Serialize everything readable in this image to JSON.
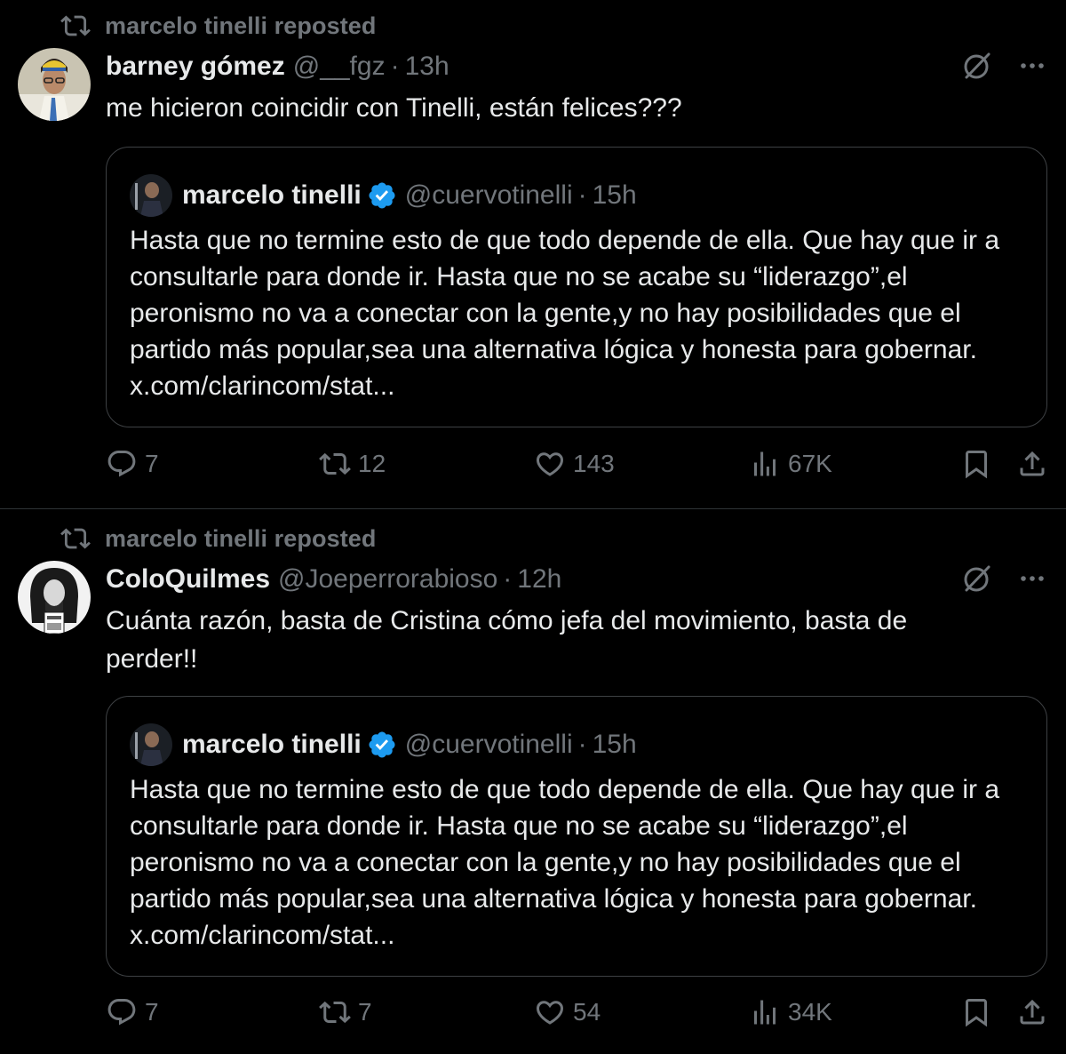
{
  "tweets": [
    {
      "reposted_by": "marcelo tinelli reposted",
      "author": {
        "name": "barney gómez",
        "handle": "@__fgz",
        "time": "13h"
      },
      "text": "me hicieron coincidir con Tinelli, están felices???",
      "quote": {
        "author": {
          "name": "marcelo tinelli",
          "handle": "@cuervotinelli",
          "time": "15h"
        },
        "text": "Hasta que no termine esto de que todo depende de ella. Que hay que ir a consultarle para donde ir. Hasta que no se acabe su “liderazgo”,el peronismo no va a conectar con la gente,y no hay posibilidades que el partido más popular,sea una alternativa lógica y honesta para gobernar. x.com/clarincom/stat..."
      },
      "stats": {
        "replies": "7",
        "reposts": "12",
        "likes": "143",
        "views": "67K"
      }
    },
    {
      "reposted_by": "marcelo tinelli reposted",
      "author": {
        "name": "ColoQuilmes",
        "handle": "@Joeperrorabioso",
        "time": "12h"
      },
      "text": "Cuánta razón, basta de Cristina cómo jefa del movimiento, basta de perder!!",
      "quote": {
        "author": {
          "name": "marcelo tinelli",
          "handle": "@cuervotinelli",
          "time": "15h"
        },
        "text": "Hasta que no termine esto de que todo depende de ella. Que hay que ir a consultarle para donde ir. Hasta que no se acabe su “liderazgo”,el peronismo no va a conectar con la gente,y no hay posibilidades que el partido más popular,sea una alternativa lógica y honesta para gobernar. x.com/clarincom/stat..."
      },
      "stats": {
        "replies": "7",
        "reposts": "7",
        "likes": "54",
        "views": "34K"
      }
    }
  ],
  "separator": "·",
  "colors": {
    "background": "#000000",
    "text": "#e7e9ea",
    "muted": "#71767b",
    "verified": "#1d9bf0",
    "border": "#3e4144"
  },
  "icons": [
    "repost-icon",
    "grok-icon",
    "more-icon",
    "verified-badge-icon",
    "reply-icon",
    "like-icon",
    "views-icon",
    "bookmark-icon",
    "share-icon"
  ]
}
